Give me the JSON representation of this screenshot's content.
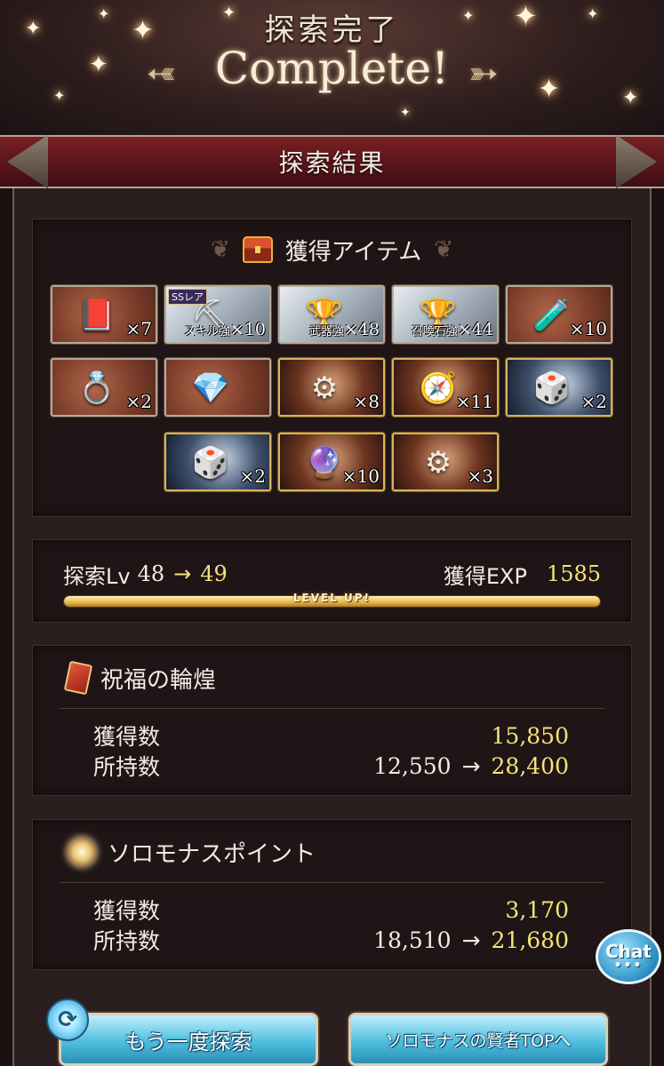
{
  "header": {
    "subtitle": "探索完了",
    "title": "Complete!"
  },
  "section": {
    "title": "探索結果"
  },
  "items": {
    "heading": "獲得アイテム",
    "tiles": [
      {
        "icon": "book-icon",
        "glyph": "📕",
        "count": "×7",
        "style": "brown"
      },
      {
        "icon": "anvil-icon",
        "glyph": "⛏",
        "badge": "SSレア",
        "caption": "スキル強",
        "count": "×10",
        "style": "steel"
      },
      {
        "icon": "blue-chalice-icon",
        "glyph": "🏆",
        "caption": "武器強",
        "count": "×48",
        "style": "steel"
      },
      {
        "icon": "red-chalice-icon",
        "glyph": "🏆",
        "caption": "召喚石強",
        "count": "×44",
        "style": "steel"
      },
      {
        "icon": "potion-icon",
        "glyph": "🧪",
        "count": "×10",
        "style": "brown"
      },
      {
        "icon": "ring-icon",
        "glyph": "💍",
        "count": "×2",
        "style": "brown"
      },
      {
        "icon": "earrings-icon",
        "glyph": "💎",
        "count": "",
        "style": "brown"
      },
      {
        "icon": "compass-emblem-icon",
        "glyph": "⚙",
        "count": "×8",
        "style": "dark-brown"
      },
      {
        "icon": "astrolabe-icon",
        "glyph": "🧭",
        "count": "×11",
        "style": "dark-brown"
      },
      {
        "icon": "gold-cube-icon",
        "glyph": "🎲",
        "count": "×2",
        "style": "dark-steel"
      },
      {
        "icon": "silver-cube-icon",
        "glyph": "🎲",
        "count": "×2",
        "style": "dark-steel"
      },
      {
        "icon": "glowing-orb-icon",
        "glyph": "🔮",
        "count": "×10",
        "style": "dark-brown"
      },
      {
        "icon": "gear-icon",
        "glyph": "⚙",
        "count": "×3",
        "style": "dark-brown"
      }
    ]
  },
  "level": {
    "label": "探索Lv",
    "from": "48",
    "arrow": "→",
    "to": "49",
    "exp_label": "獲得EXP",
    "exp_value": "1585",
    "bar_text": "LEVEL UP!",
    "progress": 1.0
  },
  "resource1": {
    "name": "祝福の輪煌",
    "gained_label": "獲得数",
    "gained": "15,850",
    "owned_label": "所持数",
    "owned_before": "12,550",
    "arrow": "→",
    "owned_after": "28,400"
  },
  "resource2": {
    "name": "ソロモナスポイント",
    "gained_label": "獲得数",
    "gained": "3,170",
    "owned_label": "所持数",
    "owned_before": "18,510",
    "arrow": "→",
    "owned_after": "21,680"
  },
  "buttons": {
    "again": "もう一度探索",
    "top": "ソロモナスの賢者TOPへ"
  },
  "chat": {
    "label": "Chat",
    "dots": "•••"
  }
}
